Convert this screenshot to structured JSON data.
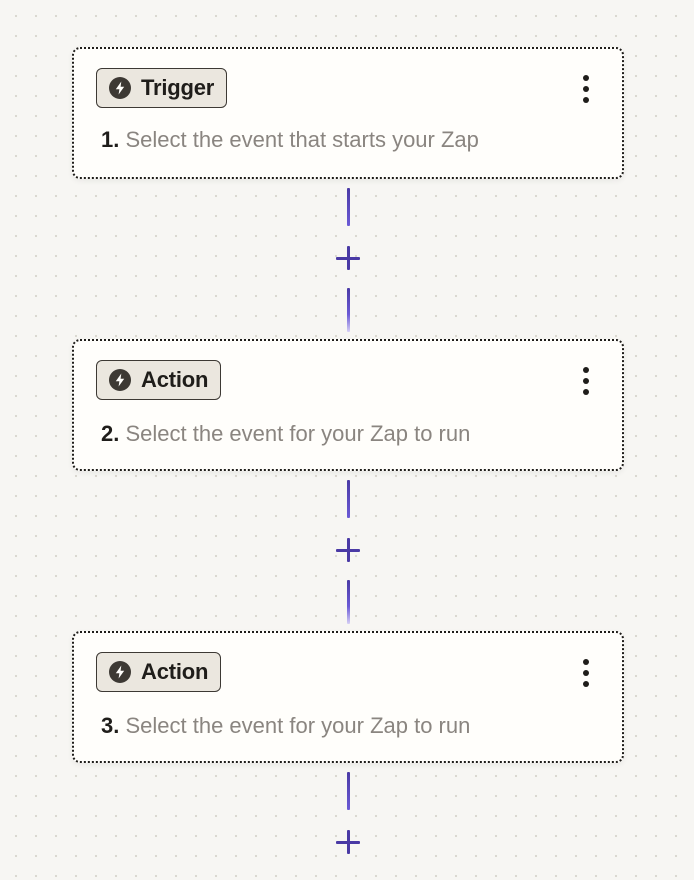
{
  "colors": {
    "background": "#f7f6f3",
    "card_border": "#1f1d1a",
    "badge_background": "#ebe7df",
    "connector_accent": "#4a3aa5",
    "step_text": "#8a8580"
  },
  "steps": [
    {
      "badge_icon": "bolt-icon",
      "badge_label": "Trigger",
      "number": "1.",
      "text": "Select the event that starts your Zap",
      "menu_icon": "more-vertical-icon"
    },
    {
      "badge_icon": "bolt-icon",
      "badge_label": "Action",
      "number": "2.",
      "text": "Select the event for your Zap to run",
      "menu_icon": "more-vertical-icon"
    },
    {
      "badge_icon": "bolt-icon",
      "badge_label": "Action",
      "number": "3.",
      "text": "Select the event for your Zap to run",
      "menu_icon": "more-vertical-icon"
    }
  ],
  "add_step_icon": "plus-icon"
}
